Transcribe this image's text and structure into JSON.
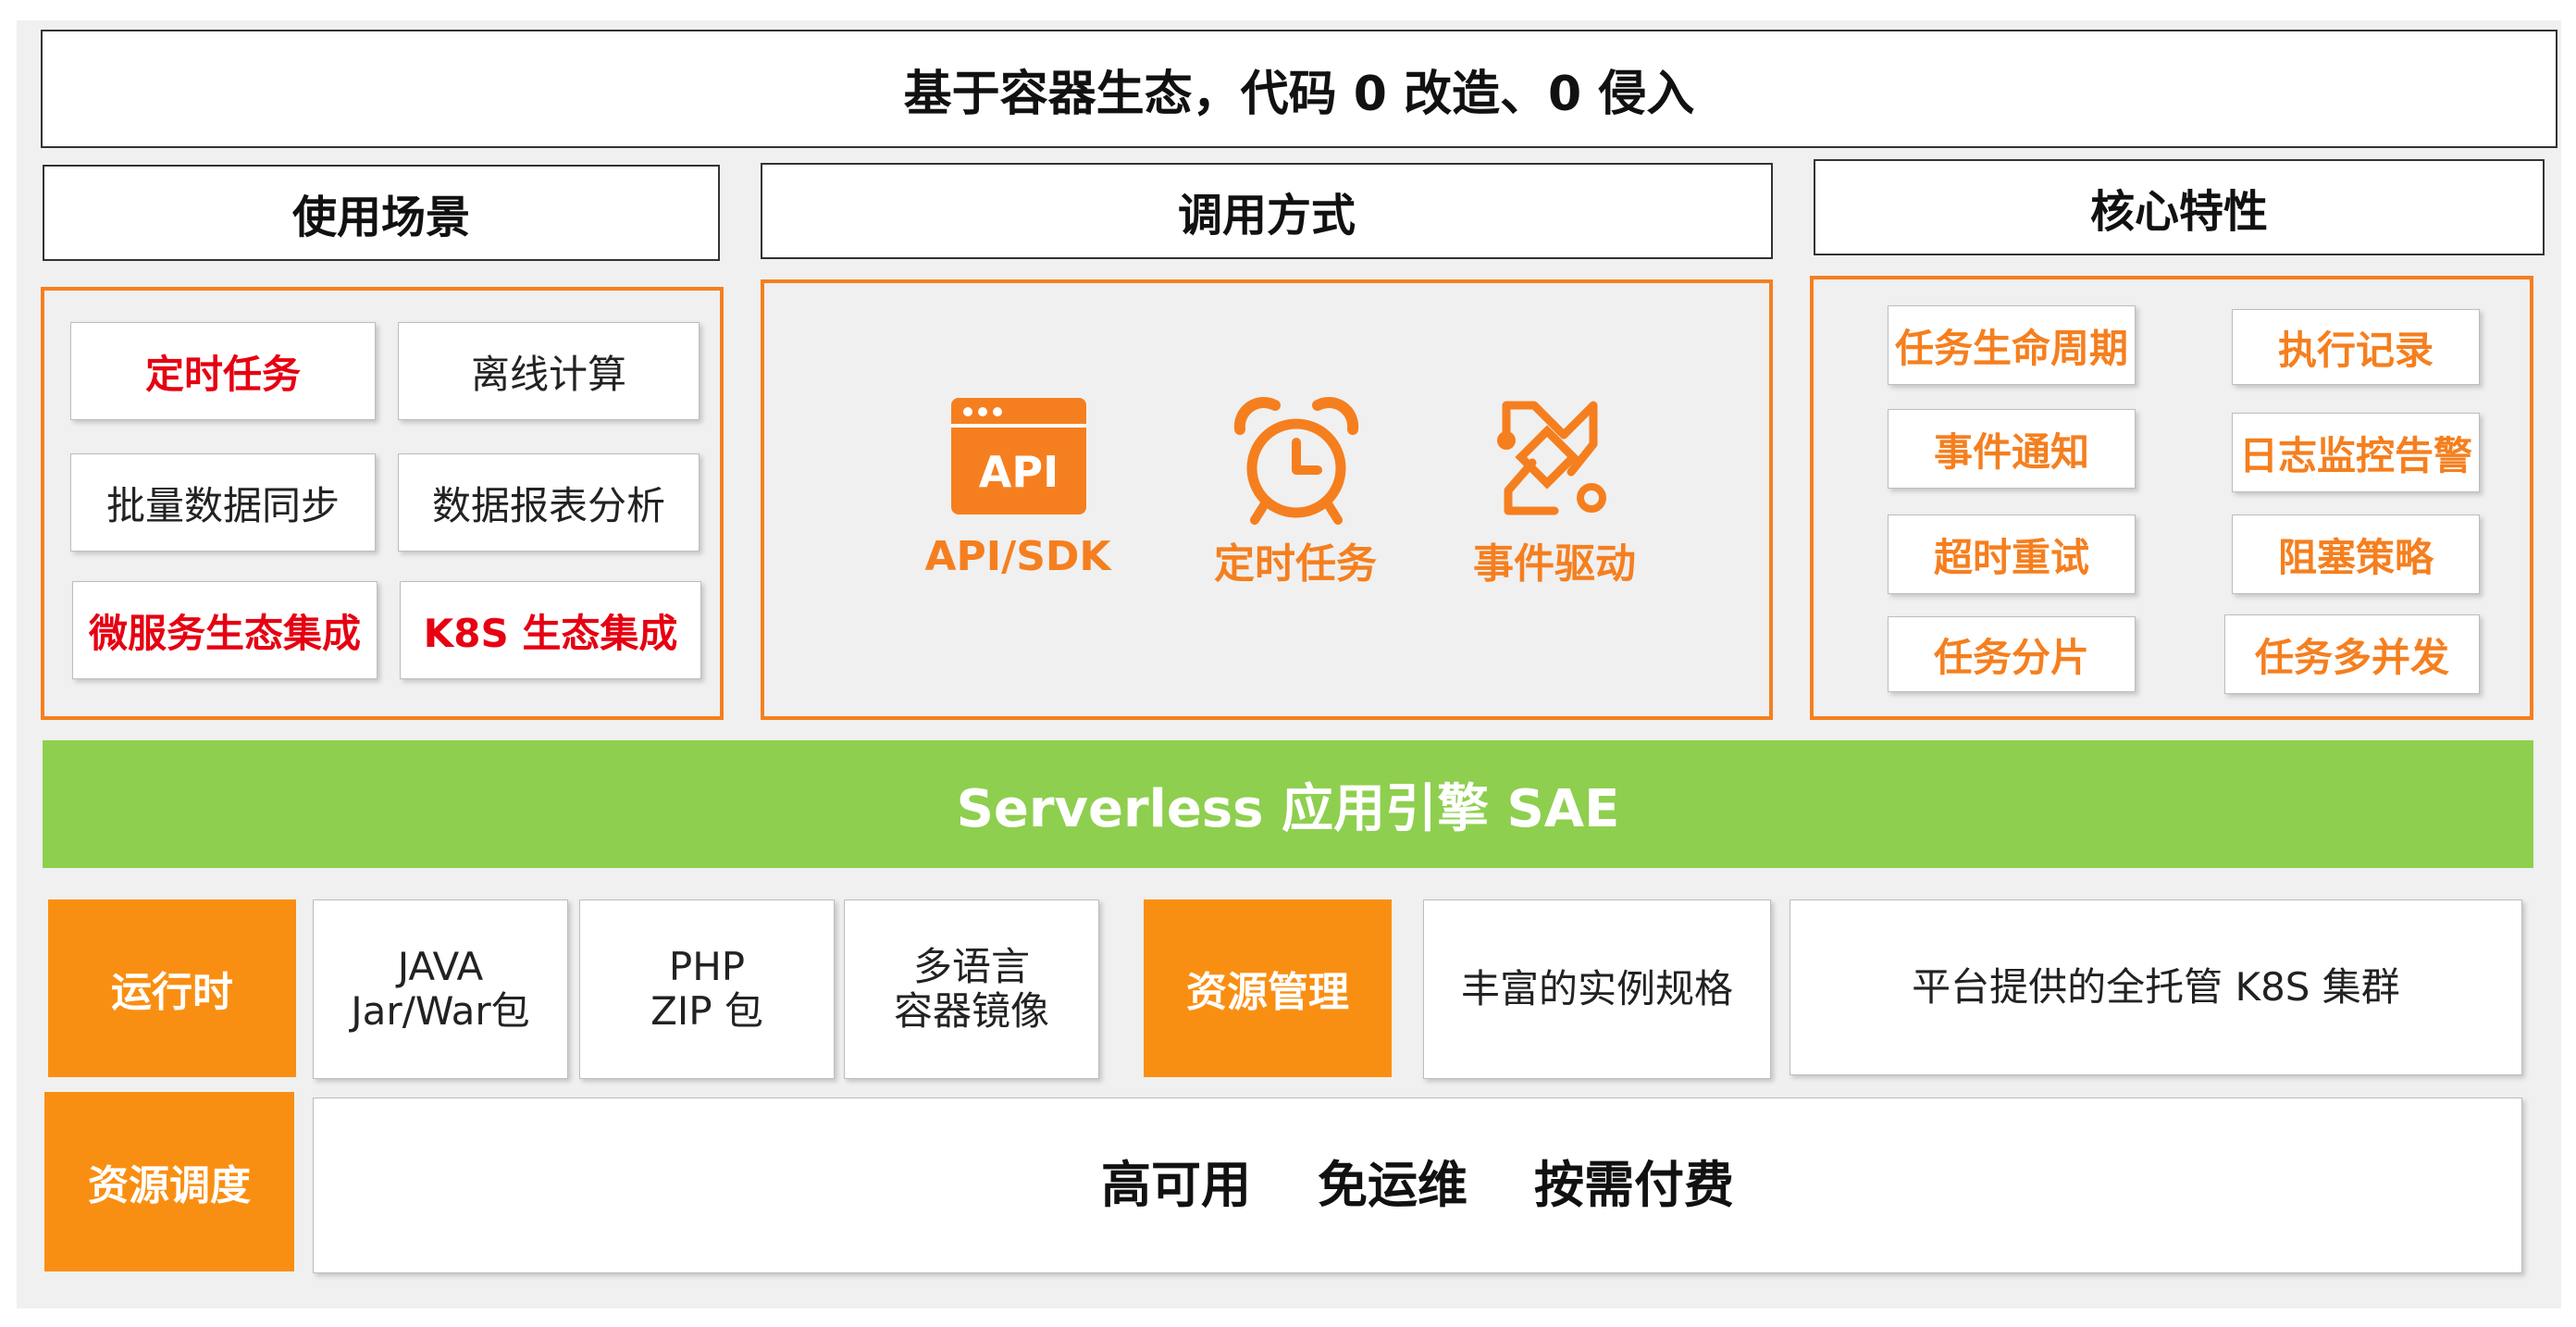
{
  "title": "基于容器生态，代码 0 改造、0 侵入",
  "headers": {
    "scenarios": "使用场景",
    "invocation": "调用方式",
    "features": "核心特性"
  },
  "scenarios": [
    {
      "label": "定时任务",
      "style": "red"
    },
    {
      "label": "离线计算",
      "style": "plain"
    },
    {
      "label": "批量数据同步",
      "style": "plain"
    },
    {
      "label": "数据报表分析",
      "style": "plain"
    },
    {
      "label": "微服务生态集成",
      "style": "red"
    },
    {
      "label": "K8S 生态集成",
      "style": "red"
    }
  ],
  "invocation_modes": [
    {
      "icon": "api-window-icon",
      "icon_text": "API",
      "label": "API/SDK"
    },
    {
      "icon": "alarm-clock-icon",
      "label": "定时任务"
    },
    {
      "icon": "event-flow-icon",
      "label": "事件驱动"
    }
  ],
  "features": [
    "任务生命周期",
    "执行记录",
    "事件通知",
    "日志监控告警",
    "超时重试",
    "阻塞策略",
    "任务分片",
    "任务多并发"
  ],
  "engine": "Serverless 应用引擎 SAE",
  "runtime": {
    "label": "运行时",
    "items": [
      {
        "line1": "JAVA",
        "line2": "Jar/War包"
      },
      {
        "line1": "PHP",
        "line2": "ZIP 包"
      },
      {
        "line1": "多语言",
        "line2": "容器镜像"
      }
    ]
  },
  "resource_mgmt": {
    "label": "资源管理",
    "items": [
      "丰富的实例规格",
      "平台提供的全托管 K8S 集群"
    ]
  },
  "scheduling": {
    "label": "资源调度",
    "items": [
      "高可用",
      "免运维",
      "按需付费"
    ]
  },
  "colors": {
    "orange": "#f57f1f",
    "red": "#e60012",
    "green": "#8ecf4f",
    "orange_block": "#f98f12"
  }
}
